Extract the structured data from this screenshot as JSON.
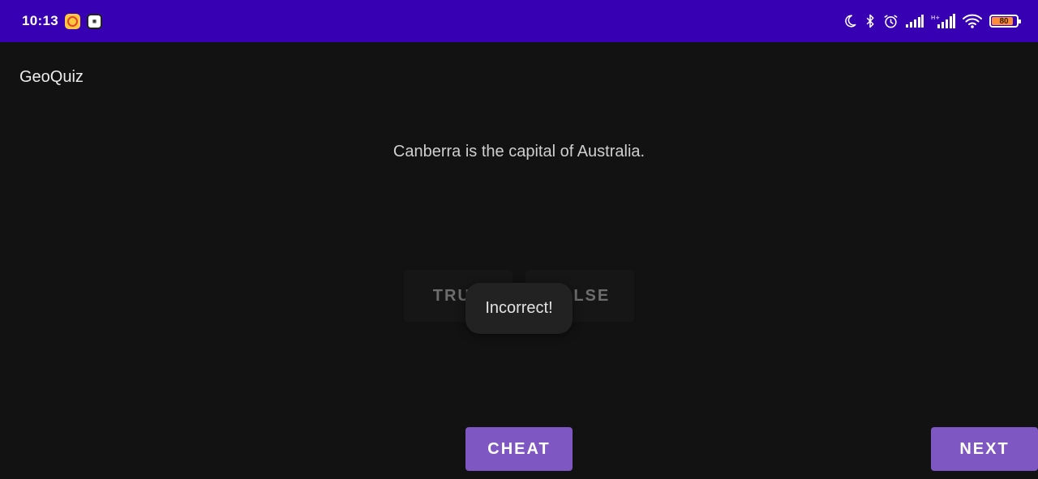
{
  "status_bar": {
    "time": "10:13",
    "left_icons": [
      "music-app-icon",
      "qr-app-icon"
    ],
    "qr_glyph": "▦",
    "right_icons": [
      "moon-icon",
      "bluetooth-icon",
      "alarm-icon",
      "signal-icon",
      "signal-hd-icon",
      "wifi-icon",
      "battery-icon"
    ],
    "battery_level": "80",
    "background_color": "#3700b3"
  },
  "app": {
    "title": "GeoQuiz"
  },
  "quiz": {
    "question": "Canberra is the capital of Australia.",
    "true_label": "TRUE",
    "false_label": "FALSE"
  },
  "toast": {
    "message": "Incorrect!"
  },
  "actions": {
    "cheat_label": "CHEAT",
    "next_label": "NEXT",
    "accent_color": "#7e57c2"
  }
}
